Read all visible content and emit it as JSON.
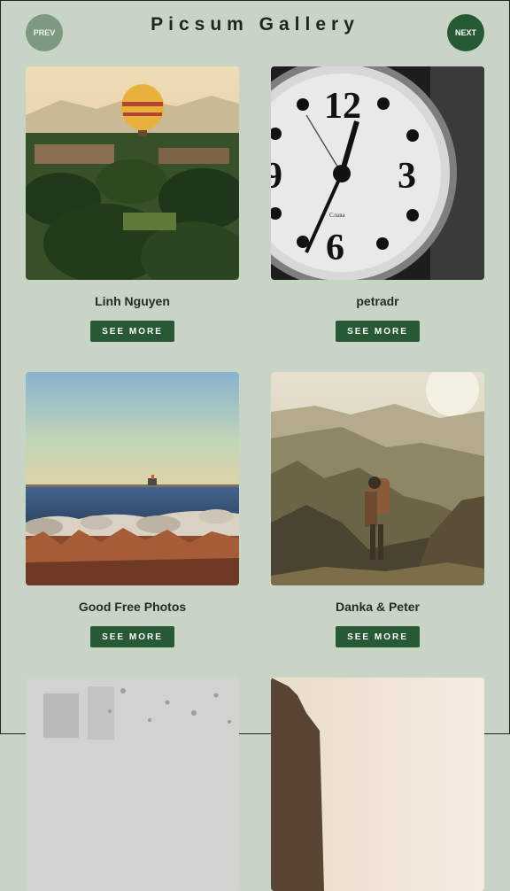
{
  "header": {
    "title": "Picsum Gallery",
    "prev_label": "PREV",
    "next_label": "NEXT"
  },
  "cards": [
    {
      "author": "Linh Nguyen",
      "button": "SEE MORE"
    },
    {
      "author": "petradr",
      "button": "SEE MORE"
    },
    {
      "author": "Good Free Photos",
      "button": "SEE MORE"
    },
    {
      "author": "Danka & Peter",
      "button": "SEE MORE"
    },
    {
      "author": "",
      "button": ""
    },
    {
      "author": "",
      "button": ""
    }
  ],
  "colors": {
    "background": "#c8d5c6",
    "accent": "#275a34",
    "prev_button": "#7d9a80"
  }
}
